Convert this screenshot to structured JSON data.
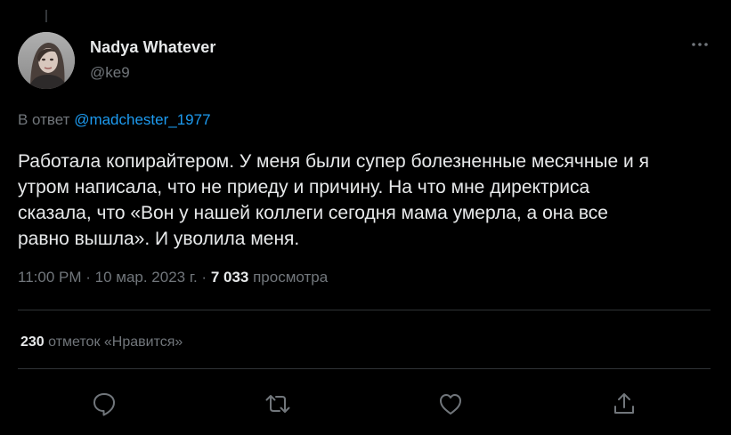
{
  "author": {
    "display_name": "Nadya Whatever",
    "handle": "@ke9"
  },
  "reply": {
    "prefix": "В ответ",
    "mention": "@madchester_1977"
  },
  "tweet": {
    "text": "Работала копирайтером. У меня были супер болезненные месячные и я\nутром написала, что не приеду и причину. На что мне директриса\nсказала, что «Вон у нашей коллеги сегодня мама умерла, а она все\nравно вышла». И уволила меня."
  },
  "meta": {
    "time": "11:00 PM",
    "sep1": " · ",
    "date": "10 мар. 2023 г.",
    "sep2": " · ",
    "views_count": "7 033",
    "views_label": " просмотра"
  },
  "likes": {
    "count": "230",
    "label": " отметок «Нравится»"
  },
  "icons": {
    "more": "more-horizontal-icon",
    "reply": "reply-icon",
    "retweet": "retweet-icon",
    "like": "heart-icon",
    "share": "share-icon"
  },
  "colors": {
    "background": "#000000",
    "text": "#e7e9ea",
    "secondary": "#71767b",
    "accent": "#1d9bf0",
    "divider": "#2f3336"
  }
}
